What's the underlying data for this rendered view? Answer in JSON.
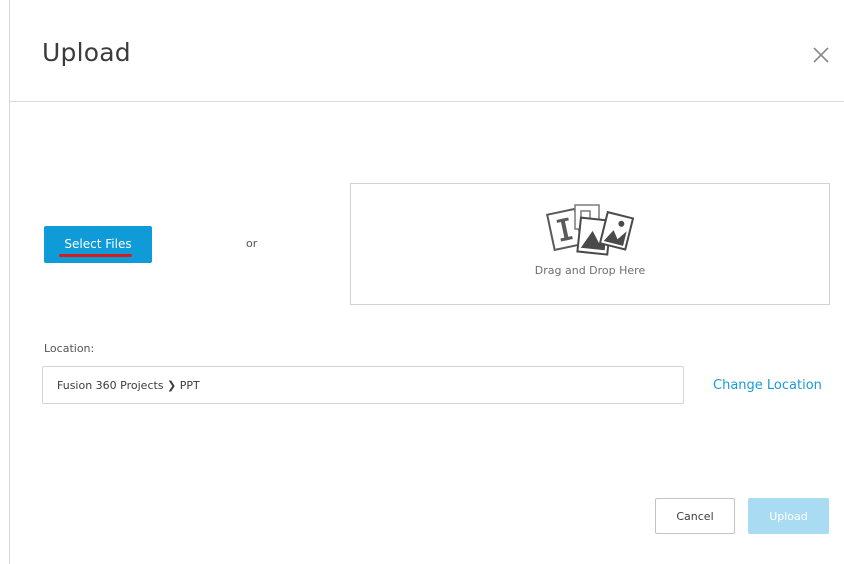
{
  "dialog": {
    "title": "Upload",
    "close_icon": "close-icon"
  },
  "select_files": {
    "label": "Select Files",
    "color": "#0e9bd8",
    "annotation_color": "#d81c1c"
  },
  "separator_text": "or",
  "dropzone": {
    "icon": "file-types-icon",
    "label": "Drag and Drop Here"
  },
  "location": {
    "label": "Location:",
    "value": "Fusion 360 Projects ❯ PPT",
    "change_label": "Change Location",
    "link_color": "#1a9ad6"
  },
  "footer": {
    "cancel_label": "Cancel",
    "upload_label": "Upload",
    "upload_enabled": false,
    "upload_color": "#a9dcf3"
  }
}
